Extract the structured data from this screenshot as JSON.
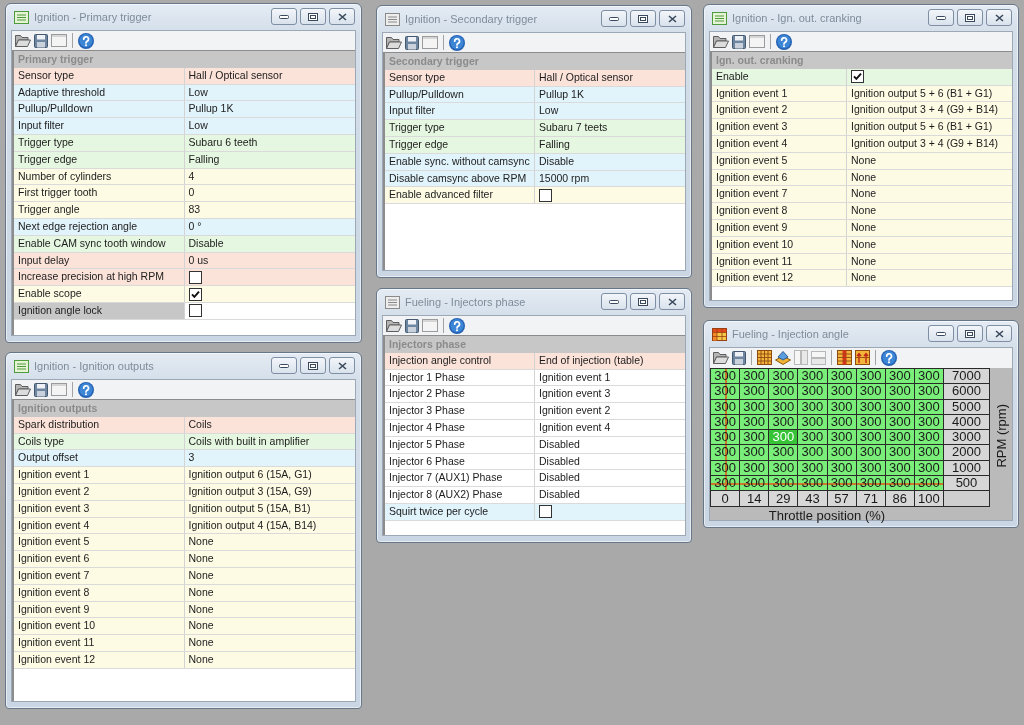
{
  "windows": [
    {
      "kind": "grid",
      "title": "Ignition - Primary trigger",
      "icon_grayed": false,
      "section": "Primary trigger",
      "rows": [
        {
          "label": "Sensor type",
          "kind": "text",
          "value": "Hall / Optical sensor",
          "color": "#fce3da",
          "selected": false
        },
        {
          "label": "Adaptive threshold",
          "kind": "text",
          "value": "Low",
          "color": "#e1f3fb",
          "selected": false
        },
        {
          "label": "Pullup/Pulldown",
          "kind": "text",
          "value": "Pullup 1K",
          "color": "#e1f3fb",
          "selected": false
        },
        {
          "label": "Input filter",
          "kind": "text",
          "value": "Low",
          "color": "#e1f3fb",
          "selected": false
        },
        {
          "label": "Trigger type",
          "kind": "text",
          "value": "Subaru 6 teeth",
          "color": "#e5f7e0",
          "selected": false
        },
        {
          "label": "Trigger edge",
          "kind": "text",
          "value": "Falling",
          "color": "#e5f7e0",
          "selected": false
        },
        {
          "label": "Number of cylinders",
          "kind": "text",
          "value": "4",
          "color": "#fdfbe4",
          "selected": false
        },
        {
          "label": "First trigger tooth",
          "kind": "text",
          "value": "0",
          "color": "#fdfbe4",
          "selected": false
        },
        {
          "label": "Trigger angle",
          "kind": "text",
          "value": "83",
          "color": "#fdfbe4",
          "selected": false
        },
        {
          "label": "Next edge rejection angle",
          "kind": "text",
          "value": "0 °",
          "color": "#e1f3fb",
          "selected": false
        },
        {
          "label": "Enable CAM sync tooth window",
          "kind": "text",
          "value": "Disable",
          "color": "#e5f7e0",
          "selected": false
        },
        {
          "label": "Input delay",
          "kind": "text",
          "value": "0 us",
          "color": "#fce3da",
          "selected": false
        },
        {
          "label": "Increase precision at high RPM",
          "kind": "checkbox",
          "checked": false,
          "color": "#fce3da",
          "selected": false
        },
        {
          "label": "Enable scope",
          "kind": "checkbox",
          "checked": true,
          "color": "#fdfbe4",
          "selected": false
        },
        {
          "label": "Ignition angle lock",
          "kind": "checkbox",
          "checked": false,
          "color": "#ffffff",
          "selected": true
        }
      ]
    },
    {
      "kind": "grid",
      "title": "Ignition - Secondary trigger",
      "icon_grayed": true,
      "section": "Secondary trigger",
      "rows": [
        {
          "label": "Sensor type",
          "kind": "text",
          "value": "Hall / Optical sensor",
          "color": "#fce3da",
          "selected": false
        },
        {
          "label": "Pullup/Pulldown",
          "kind": "text",
          "value": "Pullup 1K",
          "color": "#e1f3fb",
          "selected": false
        },
        {
          "label": "Input filter",
          "kind": "text",
          "value": "Low",
          "color": "#e1f3fb",
          "selected": false
        },
        {
          "label": "Trigger type",
          "kind": "text",
          "value": "Subaru 7 teets",
          "color": "#e5f7e0",
          "selected": false
        },
        {
          "label": "Trigger edge",
          "kind": "text",
          "value": "Falling",
          "color": "#e5f7e0",
          "selected": false
        },
        {
          "label": "Enable sync. without camsync",
          "kind": "text",
          "value": "Disable",
          "color": "#e1f3fb",
          "selected": false
        },
        {
          "label": "Disable camsync above RPM",
          "kind": "text",
          "value": "15000 rpm",
          "color": "#e1f3fb",
          "selected": false
        },
        {
          "label": "Enable advanced filter",
          "kind": "checkbox",
          "checked": false,
          "color": "#fdfbe4",
          "selected": false
        }
      ]
    },
    {
      "kind": "grid",
      "title": "Ignition - Ign. out. cranking",
      "icon_grayed": false,
      "section": "Ign. out. cranking",
      "rows": [
        {
          "label": "Enable",
          "kind": "checkbox",
          "checked": true,
          "color": "#e5f7e0",
          "selected": false
        },
        {
          "label": "Ignition event 1",
          "kind": "text",
          "value": "Ignition output 5 + 6 (B1 + G1)",
          "color": "#fdfbe4",
          "selected": false
        },
        {
          "label": "Ignition event 2",
          "kind": "text",
          "value": "Ignition output 3 + 4 (G9 + B14)",
          "color": "#fdfbe4",
          "selected": false
        },
        {
          "label": "Ignition event 3",
          "kind": "text",
          "value": "Ignition output 5 + 6 (B1 + G1)",
          "color": "#fdfbe4",
          "selected": false
        },
        {
          "label": "Ignition event 4",
          "kind": "text",
          "value": "Ignition output 3 + 4 (G9 + B14)",
          "color": "#fdfbe4",
          "selected": false
        },
        {
          "label": "Ignition event 5",
          "kind": "text",
          "value": "None",
          "color": "#fdfbe4",
          "selected": false
        },
        {
          "label": "Ignition event 6",
          "kind": "text",
          "value": "None",
          "color": "#fdfbe4",
          "selected": false
        },
        {
          "label": "Ignition event 7",
          "kind": "text",
          "value": "None",
          "color": "#fdfbe4",
          "selected": false
        },
        {
          "label": "Ignition event 8",
          "kind": "text",
          "value": "None",
          "color": "#fdfbe4",
          "selected": false
        },
        {
          "label": "Ignition event 9",
          "kind": "text",
          "value": "None",
          "color": "#fdfbe4",
          "selected": false
        },
        {
          "label": "Ignition event 10",
          "kind": "text",
          "value": "None",
          "color": "#fdfbe4",
          "selected": false
        },
        {
          "label": "Ignition event 11",
          "kind": "text",
          "value": "None",
          "color": "#fdfbe4",
          "selected": false
        },
        {
          "label": "Ignition event 12",
          "kind": "text",
          "value": "None",
          "color": "#fdfbe4",
          "selected": false
        }
      ]
    },
    {
      "kind": "grid",
      "title": "Ignition - Ignition outputs",
      "icon_grayed": false,
      "section": "Ignition outputs",
      "rows": [
        {
          "label": "Spark distribution",
          "kind": "text",
          "value": "Coils",
          "color": "#fce3da",
          "selected": false
        },
        {
          "label": "Coils type",
          "kind": "text",
          "value": "Coils with built in amplifier",
          "color": "#e5f7e0",
          "selected": false
        },
        {
          "label": "Output offset",
          "kind": "text",
          "value": "3",
          "color": "#e1f3fb",
          "selected": false
        },
        {
          "label": "Ignition event 1",
          "kind": "text",
          "value": "Ignition output 6 (15A, G1)",
          "color": "#fdfbe4",
          "selected": false
        },
        {
          "label": "Ignition event 2",
          "kind": "text",
          "value": "Ignition output 3 (15A, G9)",
          "color": "#fdfbe4",
          "selected": false
        },
        {
          "label": "Ignition event 3",
          "kind": "text",
          "value": "Ignition output 5 (15A, B1)",
          "color": "#fdfbe4",
          "selected": false
        },
        {
          "label": "Ignition event 4",
          "kind": "text",
          "value": "Ignition output 4 (15A, B14)",
          "color": "#fdfbe4",
          "selected": false
        },
        {
          "label": "Ignition event 5",
          "kind": "text",
          "value": "None",
          "color": "#fdfbe4",
          "selected": false
        },
        {
          "label": "Ignition event 6",
          "kind": "text",
          "value": "None",
          "color": "#fdfbe4",
          "selected": false
        },
        {
          "label": "Ignition event 7",
          "kind": "text",
          "value": "None",
          "color": "#fdfbe4",
          "selected": false
        },
        {
          "label": "Ignition event 8",
          "kind": "text",
          "value": "None",
          "color": "#fdfbe4",
          "selected": false
        },
        {
          "label": "Ignition event 9",
          "kind": "text",
          "value": "None",
          "color": "#fdfbe4",
          "selected": false
        },
        {
          "label": "Ignition event 10",
          "kind": "text",
          "value": "None",
          "color": "#fdfbe4",
          "selected": false
        },
        {
          "label": "Ignition event 11",
          "kind": "text",
          "value": "None",
          "color": "#fdfbe4",
          "selected": false
        },
        {
          "label": "Ignition event 12",
          "kind": "text",
          "value": "None",
          "color": "#fdfbe4",
          "selected": false
        }
      ]
    },
    {
      "kind": "grid",
      "title": "Fueling - Injectors phase",
      "icon_grayed": true,
      "section": "Injectors phase",
      "rows": [
        {
          "label": "Injection angle control",
          "kind": "text",
          "value": "End of injection (table)",
          "color": "#fce3da",
          "selected": false
        },
        {
          "label": "Injector 1 Phase",
          "kind": "text",
          "value": "Ignition event 1",
          "color": "#ffffff",
          "selected": false
        },
        {
          "label": "Injector 2 Phase",
          "kind": "text",
          "value": "Ignition event 3",
          "color": "#ffffff",
          "selected": false
        },
        {
          "label": "Injector 3 Phase",
          "kind": "text",
          "value": "Ignition event 2",
          "color": "#ffffff",
          "selected": false
        },
        {
          "label": "Injector 4 Phase",
          "kind": "text",
          "value": "Ignition event 4",
          "color": "#ffffff",
          "selected": false
        },
        {
          "label": "Injector 5 Phase",
          "kind": "text",
          "value": "Disabled",
          "color": "#ffffff",
          "selected": false
        },
        {
          "label": "Injector 6 Phase",
          "kind": "text",
          "value": "Disabled",
          "color": "#ffffff",
          "selected": false
        },
        {
          "label": "Injector 7 (AUX1) Phase",
          "kind": "text",
          "value": "Disabled",
          "color": "#ffffff",
          "selected": false
        },
        {
          "label": "Injector 8 (AUX2) Phase",
          "kind": "text",
          "value": "Disabled",
          "color": "#ffffff",
          "selected": false
        },
        {
          "label": "Squirt twice per cycle",
          "kind": "checkbox",
          "checked": false,
          "color": "#e1f3fb",
          "selected": false
        }
      ]
    },
    {
      "kind": "table",
      "title": "Fueling - Injection angle",
      "icon_grayed": false,
      "table": {
        "rows": [
          {
            "rpm": "7000",
            "cells": [
              {
                "value": "300",
                "selected": false,
                "cursor": false
              },
              {
                "value": "300",
                "selected": false,
                "cursor": false
              },
              {
                "value": "300",
                "selected": false,
                "cursor": false
              },
              {
                "value": "300",
                "selected": false,
                "cursor": false
              },
              {
                "value": "300",
                "selected": false,
                "cursor": false
              },
              {
                "value": "300",
                "selected": false,
                "cursor": false
              },
              {
                "value": "300",
                "selected": false,
                "cursor": false
              },
              {
                "value": "300",
                "selected": false,
                "cursor": false
              }
            ]
          },
          {
            "rpm": "6000",
            "cells": [
              {
                "value": "300",
                "selected": false,
                "cursor": false
              },
              {
                "value": "300",
                "selected": false,
                "cursor": false
              },
              {
                "value": "300",
                "selected": false,
                "cursor": false
              },
              {
                "value": "300",
                "selected": false,
                "cursor": false
              },
              {
                "value": "300",
                "selected": false,
                "cursor": false
              },
              {
                "value": "300",
                "selected": false,
                "cursor": false
              },
              {
                "value": "300",
                "selected": false,
                "cursor": false
              },
              {
                "value": "300",
                "selected": false,
                "cursor": false
              }
            ]
          },
          {
            "rpm": "5000",
            "cells": [
              {
                "value": "300",
                "selected": false,
                "cursor": false
              },
              {
                "value": "300",
                "selected": false,
                "cursor": false
              },
              {
                "value": "300",
                "selected": false,
                "cursor": false
              },
              {
                "value": "300",
                "selected": false,
                "cursor": false
              },
              {
                "value": "300",
                "selected": false,
                "cursor": false
              },
              {
                "value": "300",
                "selected": false,
                "cursor": false
              },
              {
                "value": "300",
                "selected": false,
                "cursor": false
              },
              {
                "value": "300",
                "selected": false,
                "cursor": false
              }
            ]
          },
          {
            "rpm": "4000",
            "cells": [
              {
                "value": "300",
                "selected": false,
                "cursor": false
              },
              {
                "value": "300",
                "selected": false,
                "cursor": false
              },
              {
                "value": "300",
                "selected": false,
                "cursor": false
              },
              {
                "value": "300",
                "selected": false,
                "cursor": false
              },
              {
                "value": "300",
                "selected": false,
                "cursor": false
              },
              {
                "value": "300",
                "selected": false,
                "cursor": false
              },
              {
                "value": "300",
                "selected": false,
                "cursor": false
              },
              {
                "value": "300",
                "selected": false,
                "cursor": false
              }
            ]
          },
          {
            "rpm": "3000",
            "cells": [
              {
                "value": "300",
                "selected": false,
                "cursor": false
              },
              {
                "value": "300",
                "selected": false,
                "cursor": false
              },
              {
                "value": "300",
                "selected": true,
                "cursor": false
              },
              {
                "value": "300",
                "selected": false,
                "cursor": false
              },
              {
                "value": "300",
                "selected": false,
                "cursor": false
              },
              {
                "value": "300",
                "selected": false,
                "cursor": false
              },
              {
                "value": "300",
                "selected": false,
                "cursor": false
              },
              {
                "value": "300",
                "selected": false,
                "cursor": false
              }
            ]
          },
          {
            "rpm": "2000",
            "cells": [
              {
                "value": "300",
                "selected": false,
                "cursor": false
              },
              {
                "value": "300",
                "selected": false,
                "cursor": false
              },
              {
                "value": "300",
                "selected": false,
                "cursor": false
              },
              {
                "value": "300",
                "selected": false,
                "cursor": false
              },
              {
                "value": "300",
                "selected": false,
                "cursor": false
              },
              {
                "value": "300",
                "selected": false,
                "cursor": false
              },
              {
                "value": "300",
                "selected": false,
                "cursor": false
              },
              {
                "value": "300",
                "selected": false,
                "cursor": false
              }
            ]
          },
          {
            "rpm": "1000",
            "cells": [
              {
                "value": "300",
                "selected": false,
                "cursor": false
              },
              {
                "value": "300",
                "selected": false,
                "cursor": false
              },
              {
                "value": "300",
                "selected": false,
                "cursor": false
              },
              {
                "value": "300",
                "selected": false,
                "cursor": false
              },
              {
                "value": "300",
                "selected": false,
                "cursor": false
              },
              {
                "value": "300",
                "selected": false,
                "cursor": false
              },
              {
                "value": "300",
                "selected": false,
                "cursor": false
              },
              {
                "value": "300",
                "selected": false,
                "cursor": false
              }
            ]
          },
          {
            "rpm": "500",
            "cells": [
              {
                "value": "300",
                "selected": false,
                "cursor": true
              },
              {
                "value": "300",
                "selected": false,
                "cursor": false
              },
              {
                "value": "300",
                "selected": false,
                "cursor": false
              },
              {
                "value": "300",
                "selected": false,
                "cursor": false
              },
              {
                "value": "300",
                "selected": false,
                "cursor": false
              },
              {
                "value": "300",
                "selected": false,
                "cursor": false
              },
              {
                "value": "300",
                "selected": false,
                "cursor": false
              },
              {
                "value": "300",
                "selected": false,
                "cursor": false
              }
            ]
          }
        ],
        "x_axis": [
          "0",
          "14",
          "29",
          "43",
          "57",
          "71",
          "86",
          "100"
        ],
        "xlabel": "Throttle position (%)",
        "ylabel": "RPM (rpm)"
      }
    }
  ]
}
